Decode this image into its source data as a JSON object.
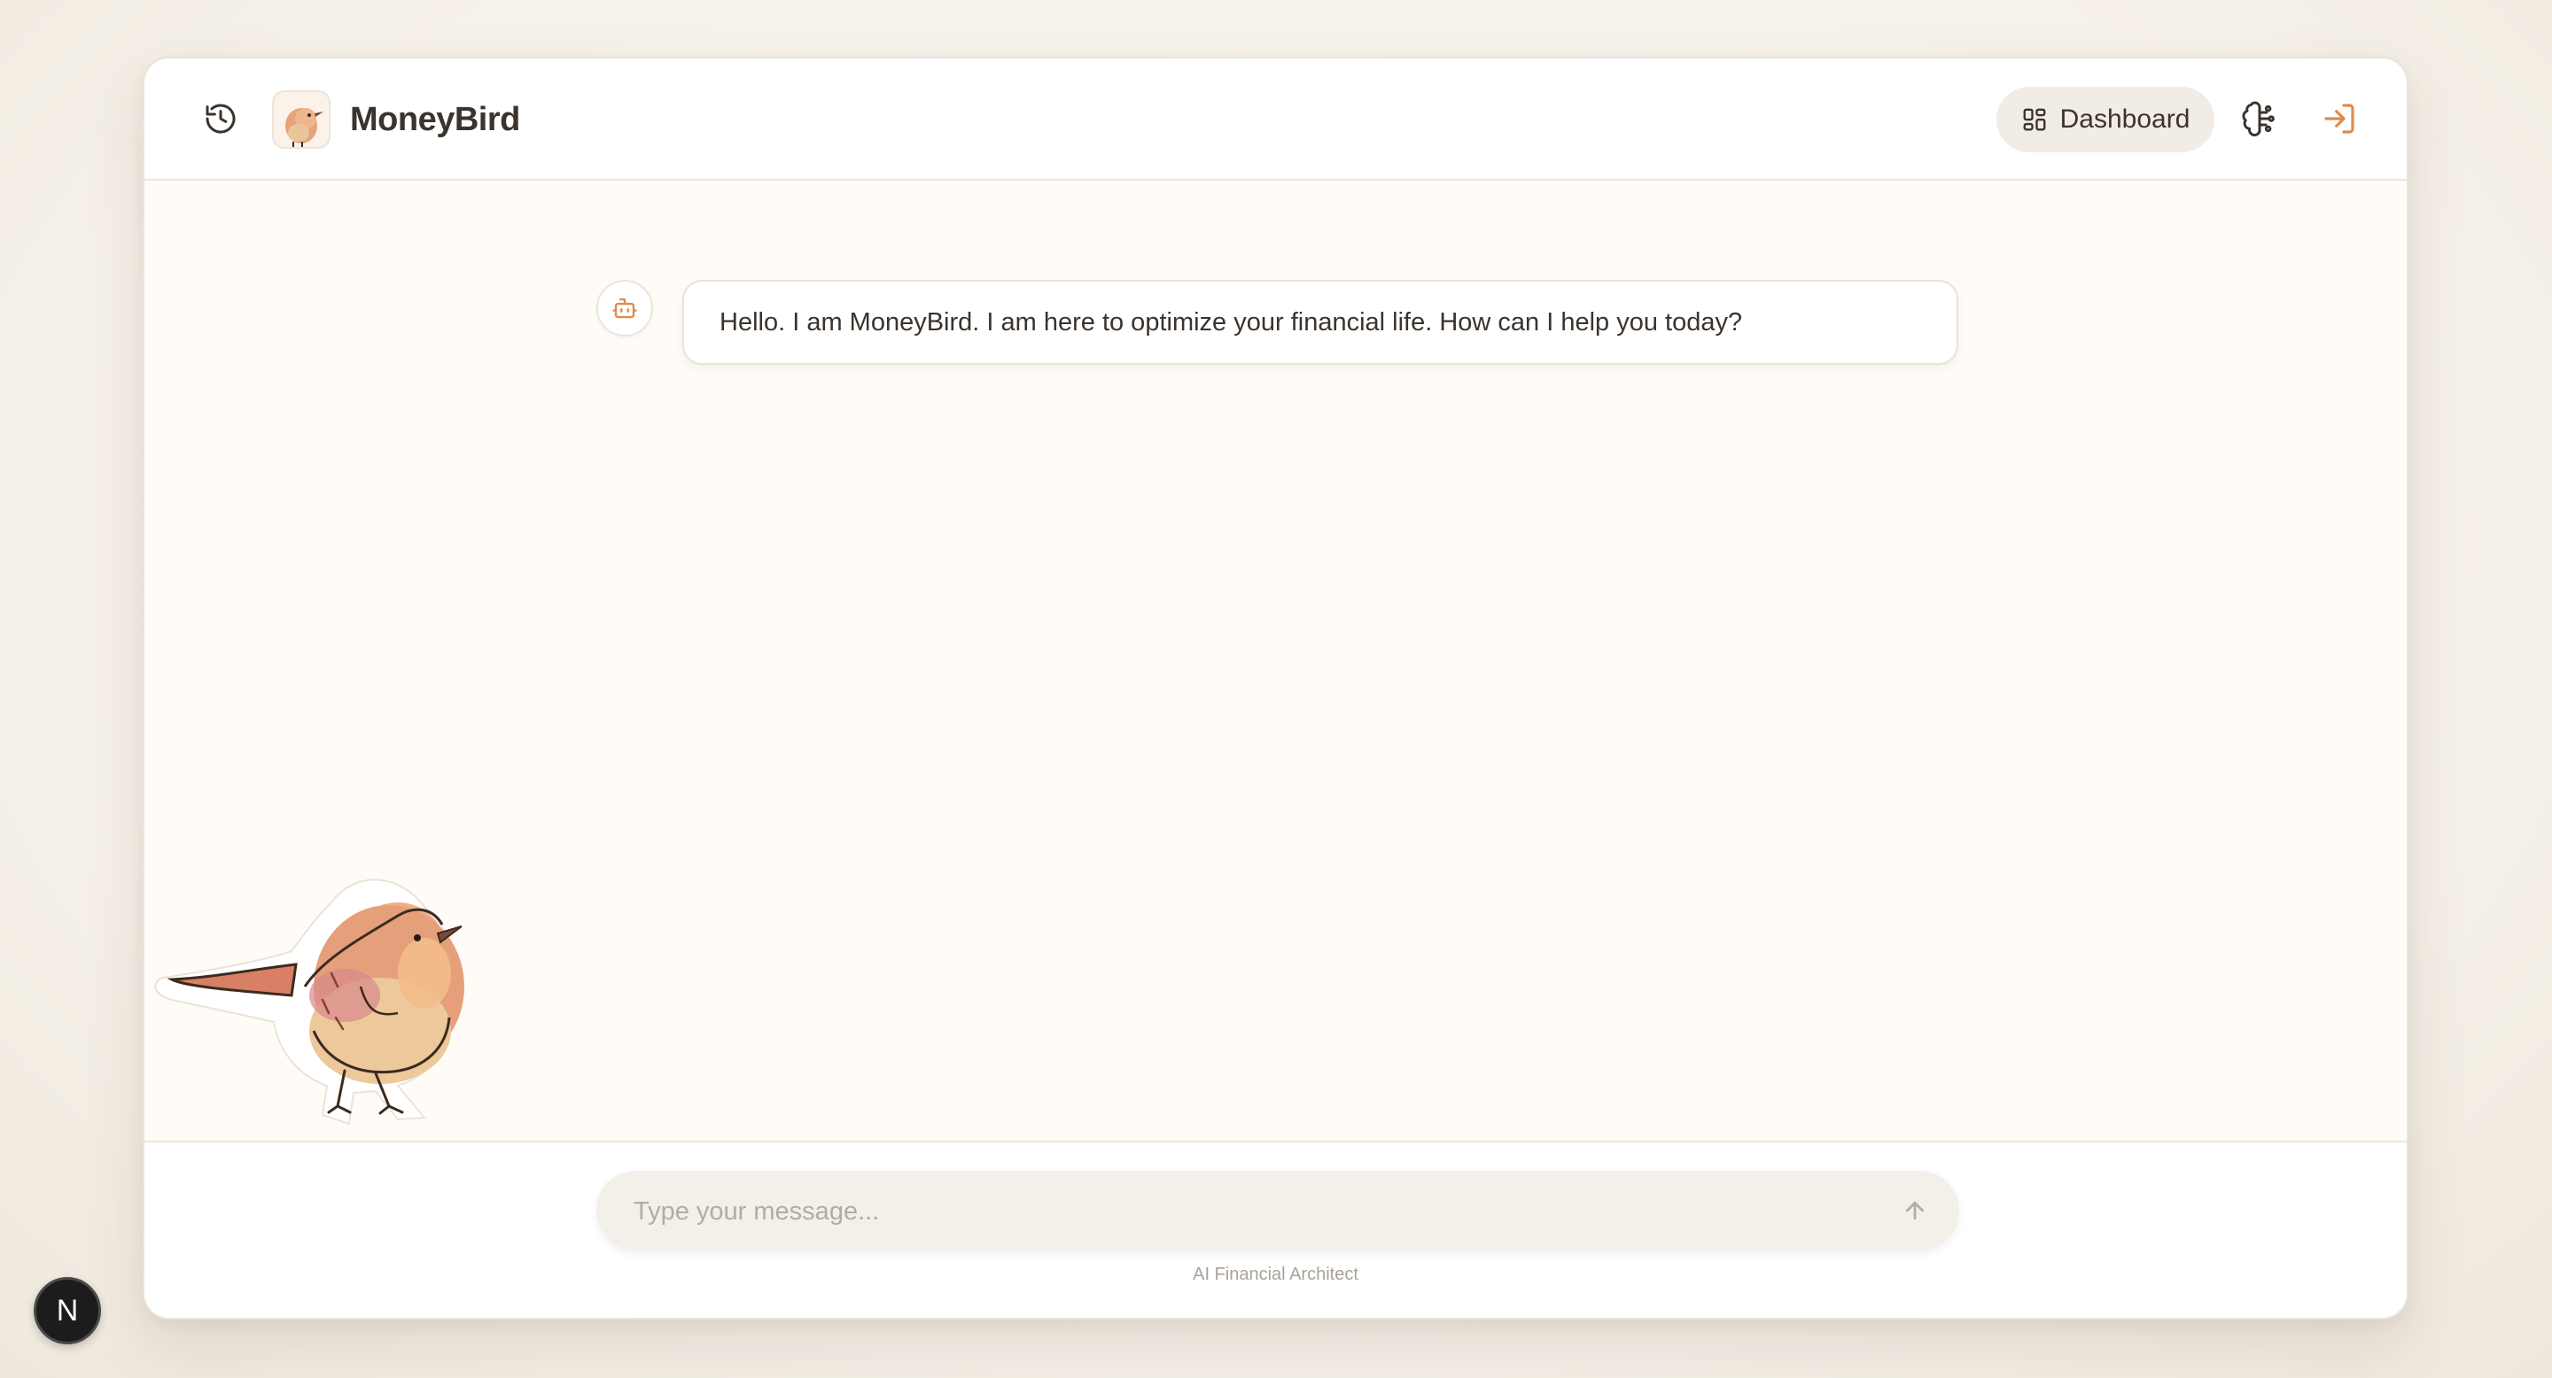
{
  "header": {
    "brand_name": "MoneyBird",
    "dashboard_label": "Dashboard",
    "icons": {
      "history": "history-icon",
      "brand": "bird-logo",
      "dashboard": "grid-icon",
      "brain": "brain-icon",
      "login": "login-icon"
    }
  },
  "chat": {
    "messages": [
      {
        "role": "assistant",
        "avatar_icon": "bot-icon",
        "text": "Hello. I am MoneyBird. I am here to optimize your financial life. How can I help you today?"
      }
    ]
  },
  "composer": {
    "value": "",
    "placeholder": "Type your message...",
    "send_icon": "arrow-up-icon",
    "caption": "AI Financial Architect"
  },
  "devtools": {
    "badge_label": "N"
  },
  "colors": {
    "background": "#f6f1ea",
    "panel": "#fffcf7",
    "accent": "#e08a4c",
    "text": "#3b332c"
  }
}
